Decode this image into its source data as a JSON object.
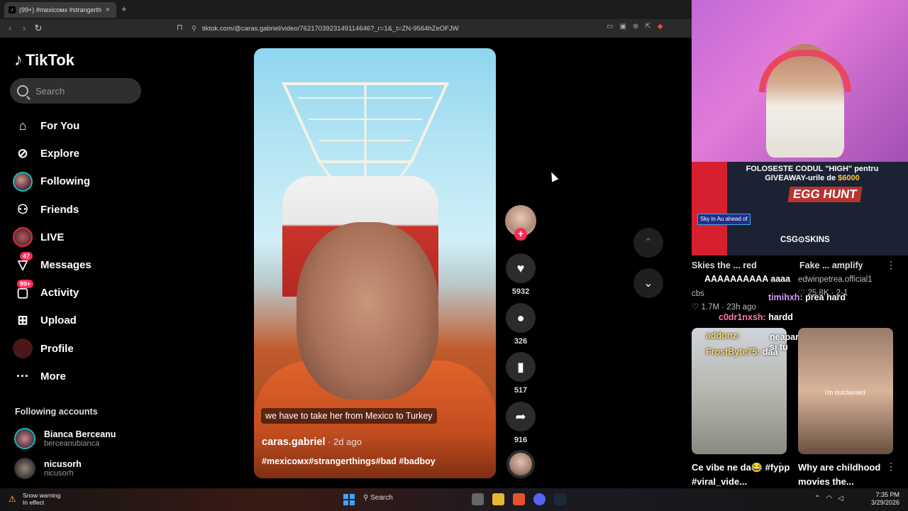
{
  "browser": {
    "tab_title": "(99+) #mexicoмх #strangerth",
    "tab_icon": "tiktok-icon",
    "new_tab": "+",
    "url": "tiktok.com/@caras.gabriel/video/7621703923149114646?_r=1&_t=ZN-9564hZeOFJW"
  },
  "tiktok": {
    "logo": "TikTok",
    "search_placeholder": "Search",
    "nav": [
      {
        "label": "For You",
        "icon": "home-icon"
      },
      {
        "label": "Explore",
        "icon": "compass-icon"
      },
      {
        "label": "Following",
        "icon": "avatar-icon"
      },
      {
        "label": "Friends",
        "icon": "friends-icon"
      },
      {
        "label": "LIVE",
        "icon": "live-icon"
      },
      {
        "label": "Messages",
        "icon": "paper-plane-icon",
        "badge": "47"
      },
      {
        "label": "Activity",
        "icon": "chat-bubble-icon",
        "badge": "99+"
      },
      {
        "label": "Upload",
        "icon": "plus-square-icon"
      },
      {
        "label": "Profile",
        "icon": "profile-avatar-icon"
      },
      {
        "label": "More",
        "icon": "more-dots-icon"
      }
    ],
    "following_title": "Following accounts",
    "following": [
      {
        "name": "Bianca Berceanu",
        "handle": "berceanubianca"
      },
      {
        "name": "nicusorh",
        "handle": "nicusorh"
      }
    ],
    "video": {
      "subtitle": "we have to take her from Mexico to Turkey",
      "author": "caras.gabriel",
      "ago": " · 2d ago",
      "tags": "#mexicoмх#strangerthings#bad #badboy"
    },
    "actions": {
      "likes": "5932",
      "comments": "326",
      "saves": "517",
      "shares": "916"
    }
  },
  "stream": {
    "promo_line1_a": "FOLOSESTE CODUL \"HIGH\" pentru",
    "promo_line2_a": "GIVEAWAY-urile de ",
    "promo_money": "$6000",
    "promo_event": "EGG HUNT",
    "promo_brand": "CSG⊙SKINS",
    "sky_chip": "Sky in Au ahead of",
    "chat": [
      {
        "user": "",
        "text": "AAAAAAAAAA aaaa"
      },
      {
        "user": "timihxh:",
        "text": "prea hard"
      },
      {
        "user": "c0dr1nxsh:",
        "text": "hardd"
      },
      {
        "user": "addonz:",
        "text": "neaparat trebuie sa mergi si tu"
      },
      {
        "user": "FrostByte75:",
        "text": "daa"
      }
    ],
    "feed_left_title": "Skies the ... red",
    "feed_left_meta": "cbs",
    "feed_left_likes": "♡ 1.7M · 23h ago",
    "feed_right_title": "Fake ... amplify",
    "feed_right_user": "edwinpetrea.official1",
    "feed_right_likes": "♡ 25.8K · 2-1",
    "thumbs": [
      {
        "caption": "Ce vibe ne da😂 #fypp #viral_vide..."
      },
      {
        "caption": "Why are childhood movies the...",
        "overlay": "i'm outclassed"
      }
    ]
  },
  "taskbar": {
    "weather_title": "Snow warning",
    "weather_sub": "In effect",
    "search": "Search",
    "time": "7:35 PM",
    "date": "3/29/2026"
  },
  "colors": {
    "accent": "#fe2c55",
    "background": "#000000"
  }
}
